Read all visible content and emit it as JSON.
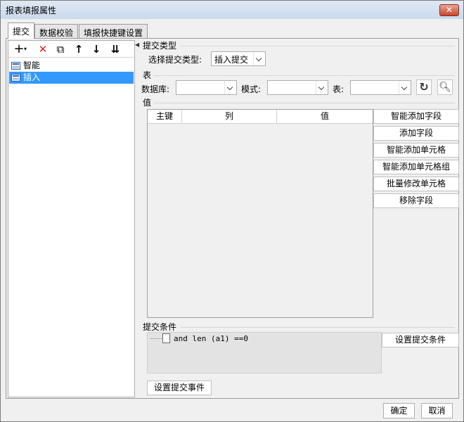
{
  "window": {
    "title": "报表填报属性",
    "close_label": "✕"
  },
  "tabs": [
    {
      "label": "提交"
    },
    {
      "label": "数据校验"
    },
    {
      "label": "填报快捷键设置"
    }
  ],
  "toolbar": {
    "add": "+",
    "delete": "✕",
    "copy": "⧉",
    "up": "↑",
    "down": "↓",
    "sort": "⇊"
  },
  "tree": {
    "items": [
      {
        "label": "智能"
      },
      {
        "label": "插入"
      }
    ]
  },
  "submit_type": {
    "section": "提交类型",
    "select_label": "选择提交类型:",
    "select_value": "插入提交"
  },
  "table": {
    "section": "表",
    "database_label": "数据库:",
    "database_value": "",
    "mode_label": "模式:",
    "mode_value": "",
    "table_label": "表:",
    "table_value": ""
  },
  "values": {
    "section": "值",
    "columns": [
      "主键",
      "列",
      "值"
    ],
    "buttons": {
      "smart_add_field": "智能添加字段",
      "add_field": "添加字段",
      "smart_add_cell": "智能添加单元格",
      "smart_add_cell_group": "智能添加单元格组",
      "batch_modify_cells": "批量修改单元格",
      "remove_field": "移除字段"
    }
  },
  "condition": {
    "section": "提交条件",
    "expression": "and len (a1) ==0",
    "set_button": "设置提交条件"
  },
  "event_button": "设置提交事件",
  "footer": {
    "ok": "确定",
    "cancel": "取消"
  }
}
